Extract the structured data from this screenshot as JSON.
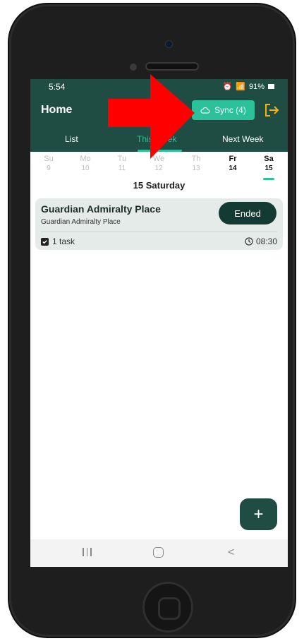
{
  "status_bar": {
    "time": "5:54",
    "battery": "91%"
  },
  "header": {
    "title": "Home",
    "sync_label": "Sync (4)"
  },
  "tabs": [
    {
      "label": "List"
    },
    {
      "label": "This Week",
      "active": true
    },
    {
      "label": "Next Week"
    }
  ],
  "week": [
    {
      "day": "Su",
      "date": "9"
    },
    {
      "day": "Mo",
      "date": "10"
    },
    {
      "day": "Tu",
      "date": "11"
    },
    {
      "day": "We",
      "date": "12"
    },
    {
      "day": "Th",
      "date": "13"
    },
    {
      "day": "Fr",
      "date": "14"
    },
    {
      "day": "Sa",
      "date": "15",
      "selected": true
    }
  ],
  "date_heading": "15 Saturday",
  "event": {
    "title": "Guardian Admiralty Place",
    "subtitle": "Guardian Admiralty Place",
    "status": "Ended",
    "tasks": "1 task",
    "time": "08:30"
  },
  "fab_label": "+",
  "colors": {
    "header": "#1f4d43",
    "accent": "#2cc19a",
    "annotation_arrow": "#ff0000"
  }
}
